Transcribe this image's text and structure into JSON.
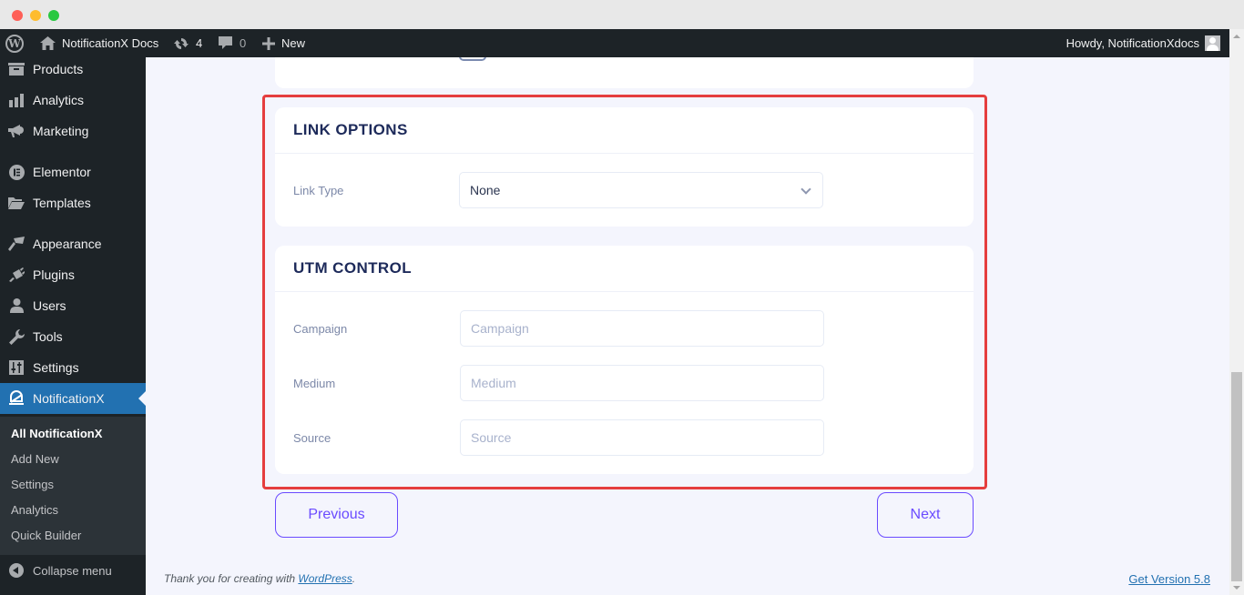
{
  "adminbar": {
    "site_name": "NotificationX Docs",
    "updates_count": "4",
    "comments_count": "0",
    "new_label": "New",
    "howdy": "Howdy, NotificationXdocs"
  },
  "sidebar": {
    "items": [
      {
        "label": "Products",
        "icon": "archive-icon"
      },
      {
        "label": "Analytics",
        "icon": "bar-chart-icon"
      },
      {
        "label": "Marketing",
        "icon": "megaphone-icon"
      },
      {
        "label": "Elementor",
        "icon": "elementor-icon"
      },
      {
        "label": "Templates",
        "icon": "folder-icon"
      },
      {
        "label": "Appearance",
        "icon": "paintbrush-icon"
      },
      {
        "label": "Plugins",
        "icon": "plug-icon"
      },
      {
        "label": "Users",
        "icon": "user-icon"
      },
      {
        "label": "Tools",
        "icon": "wrench-icon"
      },
      {
        "label": "Settings",
        "icon": "sliders-icon"
      },
      {
        "label": "NotificationX",
        "icon": "bell-icon",
        "active": true
      }
    ],
    "submenu": [
      {
        "label": "All NotificationX",
        "current": true
      },
      {
        "label": "Add New"
      },
      {
        "label": "Settings"
      },
      {
        "label": "Analytics"
      },
      {
        "label": "Quick Builder"
      }
    ],
    "collapse_label": "Collapse menu"
  },
  "link_options": {
    "title": "LINK OPTIONS",
    "link_type_label": "Link Type",
    "link_type_value": "None"
  },
  "utm_control": {
    "title": "UTM CONTROL",
    "fields": [
      {
        "label": "Campaign",
        "placeholder": "Campaign",
        "value": ""
      },
      {
        "label": "Medium",
        "placeholder": "Medium",
        "value": ""
      },
      {
        "label": "Source",
        "placeholder": "Source",
        "value": ""
      }
    ]
  },
  "nav": {
    "previous_label": "Previous",
    "next_label": "Next"
  },
  "footer": {
    "thanks_prefix": "Thank you for creating with ",
    "wordpress_link": "WordPress",
    "thanks_suffix": ".",
    "version_link": "Get Version 5.8"
  },
  "colors": {
    "accent": "#6a4bff",
    "wp_blue": "#2271b1",
    "highlight_border": "#e53e3e",
    "admin_dark": "#1d2327",
    "heading": "#1d2a5a"
  }
}
